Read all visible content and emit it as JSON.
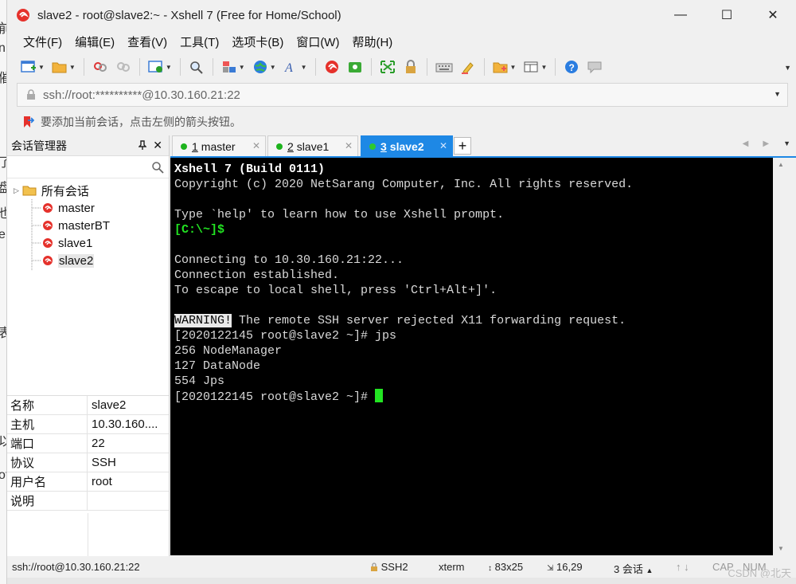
{
  "window": {
    "title": "slave2 - root@slave2:~ - Xshell 7 (Free for Home/School)",
    "controls": {
      "minimize": "—",
      "maximize": "☐",
      "close": "✕"
    }
  },
  "menu": [
    "文件(F)",
    "编辑(E)",
    "查看(V)",
    "工具(T)",
    "选项卡(B)",
    "窗口(W)",
    "帮助(H)"
  ],
  "address": {
    "text": "ssh://root:**********@10.30.160.21:22"
  },
  "hint": {
    "text": "要添加当前会话，点击左侧的箭头按钮。"
  },
  "session_manager": {
    "title": "会话管理器",
    "pin": "📌",
    "close": "✕",
    "root": "所有会话",
    "sessions": [
      "master",
      "masterBT",
      "slave1",
      "slave2"
    ],
    "selected": "slave2",
    "properties": [
      {
        "key": "名称",
        "value": "slave2"
      },
      {
        "key": "主机",
        "value": "10.30.160...."
      },
      {
        "key": "端口",
        "value": "22"
      },
      {
        "key": "协议",
        "value": "SSH"
      },
      {
        "key": "用户名",
        "value": "root"
      },
      {
        "key": "说明",
        "value": ""
      }
    ]
  },
  "tabs": [
    {
      "num": "1",
      "label": "master",
      "active": false
    },
    {
      "num": "2",
      "label": "slave1",
      "active": false
    },
    {
      "num": "3",
      "label": "slave2",
      "active": true
    }
  ],
  "terminal": {
    "lines": [
      {
        "text": "Xshell 7 (Build 0111)",
        "style": "bold"
      },
      {
        "text": "Copyright (c) 2020 NetSarang Computer, Inc. All rights reserved.",
        "style": "plain"
      },
      {
        "text": "",
        "style": "plain"
      },
      {
        "text": "Type `help' to learn how to use Xshell prompt.",
        "style": "plain"
      },
      {
        "text": "[C:\\~]$",
        "style": "green"
      },
      {
        "text": "",
        "style": "plain"
      },
      {
        "text": "Connecting to 10.30.160.21:22...",
        "style": "plain"
      },
      {
        "text": "Connection established.",
        "style": "plain"
      },
      {
        "text": "To escape to local shell, press 'Ctrl+Alt+]'.",
        "style": "plain"
      },
      {
        "text": "",
        "style": "plain"
      },
      {
        "text": "The remote SSH server rejected X11 forwarding request.",
        "style": "warning",
        "tag": "WARNING!"
      },
      {
        "text": "[2020122145 root@slave2 ~]# jps",
        "style": "plain"
      },
      {
        "text": "256 NodeManager",
        "style": "plain"
      },
      {
        "text": "127 DataNode",
        "style": "plain"
      },
      {
        "text": "554 Jps",
        "style": "plain"
      },
      {
        "text": "[2020122145 root@slave2 ~]# ",
        "style": "prompt"
      }
    ]
  },
  "status": {
    "connection": "ssh://root@10.30.160.21:22",
    "protocol": "SSH2",
    "terminal_type": "xterm",
    "size": "83x25",
    "cursor_pos": "16,29",
    "sessions": "3 会话",
    "cap": "CAP",
    "num": "NUM"
  },
  "watermark": "CSDN @北天",
  "colors": {
    "accent": "#1e88e5",
    "terminal_bg": "#000000",
    "prompt_green": "#22e422"
  }
}
